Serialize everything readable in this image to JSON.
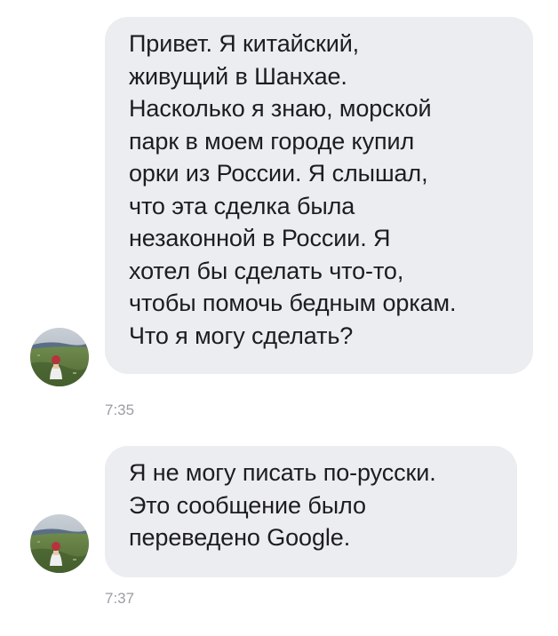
{
  "messages": [
    {
      "lines": [
        "Привет. Я китайский,",
        "живущий в Шанхае.",
        "Насколько я знаю, морской",
        "парк в моем городе купил",
        "орки из России. Я слышал,",
        "что эта сделка была",
        "незаконной в России. Я",
        "хотел бы сделать что-то,",
        "чтобы помочь бедным оркам.",
        "Что я могу сделать?"
      ],
      "time": "7:35",
      "avatar_icon": "user-photo-avatar"
    },
    {
      "lines": [
        "Я не могу писать по-русски.",
        "Это сообщение было",
        "переведено Google."
      ],
      "time": "7:37",
      "avatar_icon": "user-photo-avatar"
    }
  ],
  "colors": {
    "bubble_background": "#ebedf1",
    "text": "#1d1d1f",
    "timestamp": "#9a9da3"
  }
}
